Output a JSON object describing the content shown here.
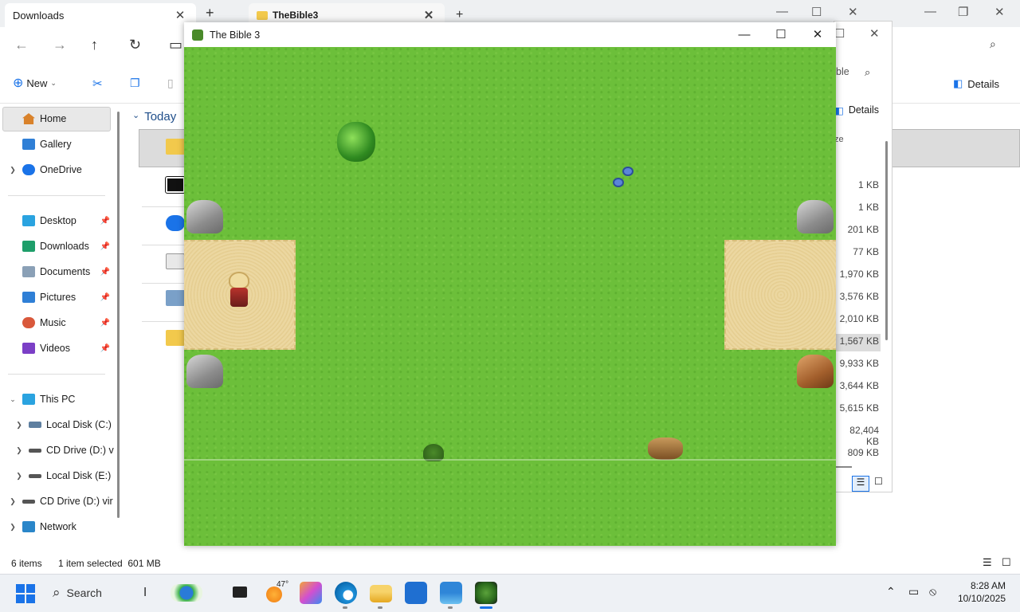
{
  "explorer": {
    "tab_title": "Downloads",
    "tab2_title": "TheBible3",
    "new_label": "New",
    "details_label": "Details",
    "today_label": "Today",
    "sidebar": [
      {
        "label": "Home"
      },
      {
        "label": "Gallery"
      },
      {
        "label": "OneDrive"
      },
      {
        "label": "Desktop"
      },
      {
        "label": "Downloads"
      },
      {
        "label": "Documents"
      },
      {
        "label": "Pictures"
      },
      {
        "label": "Music"
      },
      {
        "label": "Videos"
      },
      {
        "label": "This PC"
      },
      {
        "label": "Local Disk (C:)"
      },
      {
        "label": "CD Drive (D:) v"
      },
      {
        "label": "Local Disk (E:)"
      },
      {
        "label": "CD Drive (D:) vir"
      },
      {
        "label": "Network"
      }
    ],
    "status_items": "6 items",
    "status_selected": "1 item selected  601 MB"
  },
  "explorer2": {
    "search_partial": "ble",
    "details_label": "Details",
    "size_header": "ze",
    "sizes": [
      "1 KB",
      "1 KB",
      "201 KB",
      "77 KB",
      "1,970 KB",
      "3,576 KB",
      "2,010 KB",
      "1,567 KB",
      "9,933 KB",
      "3,644 KB",
      "5,615 KB",
      "82,404 KB",
      "809 KB"
    ]
  },
  "game": {
    "title": "The Bible 3"
  },
  "taskbar": {
    "search_placeholder": "Search",
    "weather_temp": "47°",
    "time": "8:28 AM",
    "date": "10/10/2025"
  },
  "colors": {
    "grass": "#6cbf3a",
    "sand": "#e8d29a",
    "accent": "#1a73e8"
  }
}
